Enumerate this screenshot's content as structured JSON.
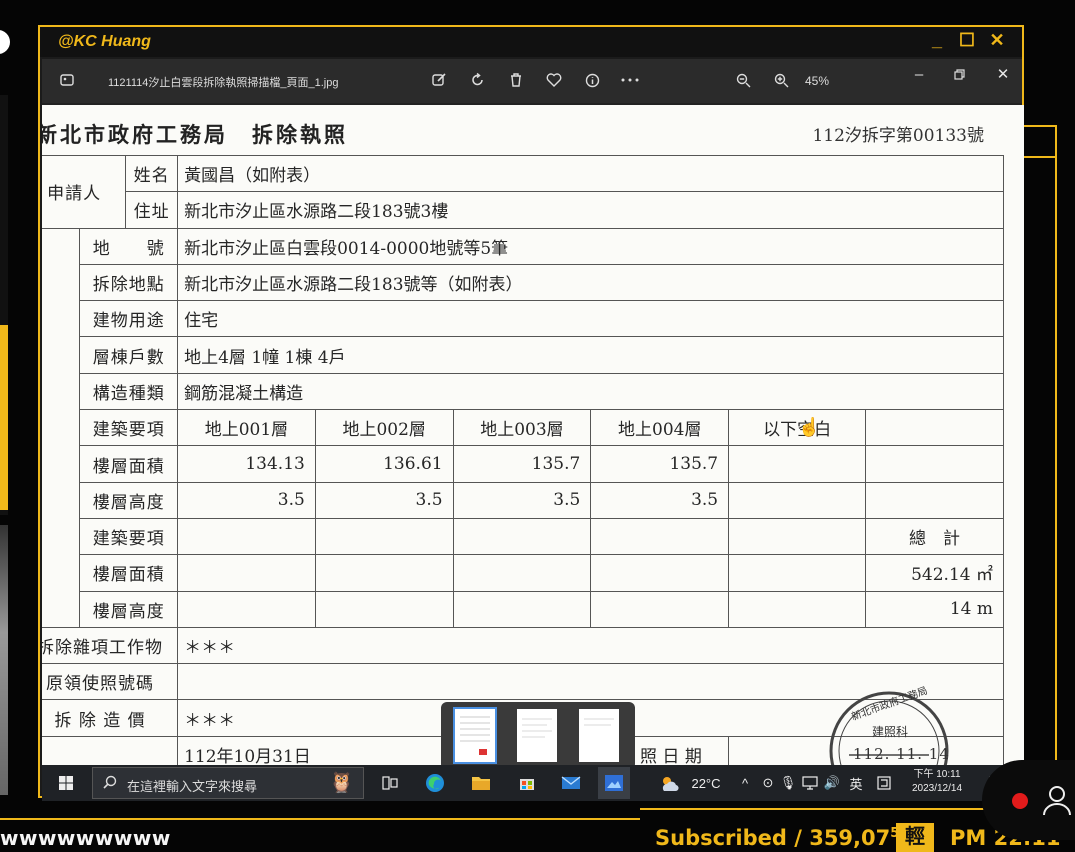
{
  "stream": {
    "ticker": "wwwwwwwww",
    "subscribed": "Subscribed / 359,07",
    "subscribed_tail": "5",
    "badge": "輕",
    "clock": "PM 22:11"
  },
  "outer_window": {
    "title": "@KC Huang",
    "minimize": "_",
    "maximize": "☐",
    "close": "✕"
  },
  "viewer": {
    "filename": "1121114汐止白雲段拆除執照掃描檔_頁面_1.jpg",
    "zoom": "45%"
  },
  "document": {
    "title": "新北市政府工務局　拆除執照",
    "permit_no": "112汐拆字第00133號",
    "applicant_group": "申請人",
    "name_label": "姓名",
    "name_value": "黃國昌（如附表）",
    "addr_label": "住址",
    "addr_value": "新北市汐止區水源路二段183號3樓",
    "lot_label": "地　　號",
    "lot_value": "新北市汐止區白雲段0014-0000地號等5筆",
    "loc_label": "拆除地點",
    "loc_value": "新北市汐止區水源路二段183號等（如附表）",
    "use_label": "建物用途",
    "use_value": "住宅",
    "floors_label": "層棟戶數",
    "floors_value": "地上4層 1幢 1棟 4戶",
    "struct_label": "構造種類",
    "struct_value": "鋼筋混凝土構造",
    "item_label": "建築要項",
    "area_label": "樓層面積",
    "height_label": "樓層高度",
    "floor_cols": [
      "地上001層",
      "地上002層",
      "地上003層",
      "地上004層",
      "以下空白"
    ],
    "areas": [
      "134.13",
      "136.61",
      "135.7",
      "135.7"
    ],
    "heights": [
      "3.5",
      "3.5",
      "3.5",
      "3.5"
    ],
    "total_label": "總　計",
    "total_area": "542.14 ㎡",
    "total_height": "14 m",
    "misc_label": "拆除雜項工作物",
    "misc_value": "＊＊＊",
    "usage_permit_label": "原領使照號碼",
    "cost_label": "拆 除 造 價",
    "cost_value": "＊＊＊",
    "date_partial": "112年10月31日",
    "issue_label": "領 照 日 期",
    "stamp_top": "新北市政府工務局",
    "stamp_mid": "建照科",
    "stamp_date": "112. 11. 14"
  },
  "taskbar": {
    "search_placeholder": "在這裡輸入文字來搜尋",
    "weather": "22°C",
    "ime": "英",
    "time": "下午 10:11",
    "date": "2023/12/14"
  }
}
